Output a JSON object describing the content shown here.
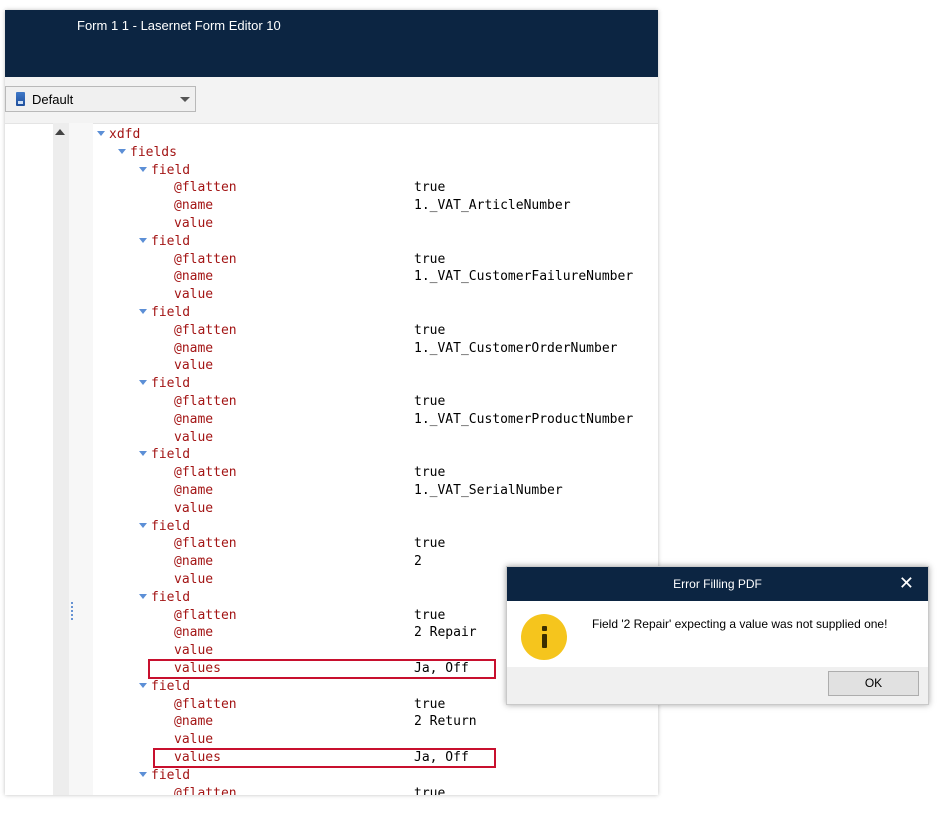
{
  "window": {
    "title": "Form 1 1 - Lasernet Form Editor 10"
  },
  "toolbar": {
    "selected_value": "Default"
  },
  "tree": {
    "root": "xdfd",
    "fields_label": "fields",
    "nodes": [
      {
        "name": "field",
        "attrs": [
          {
            "k": "@flatten",
            "v": "true"
          },
          {
            "k": "@name",
            "v": "1._VAT_ArticleNumber"
          }
        ],
        "value_label": "value"
      },
      {
        "name": "field",
        "attrs": [
          {
            "k": "@flatten",
            "v": "true"
          },
          {
            "k": "@name",
            "v": "1._VAT_CustomerFailureNumber"
          }
        ],
        "value_label": "value"
      },
      {
        "name": "field",
        "attrs": [
          {
            "k": "@flatten",
            "v": "true"
          },
          {
            "k": "@name",
            "v": "1._VAT_CustomerOrderNumber"
          }
        ],
        "value_label": "value"
      },
      {
        "name": "field",
        "attrs": [
          {
            "k": "@flatten",
            "v": "true"
          },
          {
            "k": "@name",
            "v": "1._VAT_CustomerProductNumber"
          }
        ],
        "value_label": "value"
      },
      {
        "name": "field",
        "attrs": [
          {
            "k": "@flatten",
            "v": "true"
          },
          {
            "k": "@name",
            "v": "1._VAT_SerialNumber"
          }
        ],
        "value_label": "value"
      },
      {
        "name": "field",
        "attrs": [
          {
            "k": "@flatten",
            "v": "true"
          },
          {
            "k": "@name",
            "v": "2"
          }
        ],
        "value_label": "value"
      },
      {
        "name": "field",
        "attrs": [
          {
            "k": "@flatten",
            "v": "true"
          },
          {
            "k": "@name",
            "v": "2 Repair"
          }
        ],
        "value_label": "value",
        "values": {
          "k": "values",
          "v": "Ja, Off"
        }
      },
      {
        "name": "field",
        "attrs": [
          {
            "k": "@flatten",
            "v": "true"
          },
          {
            "k": "@name",
            "v": "2 Return"
          }
        ],
        "value_label": "value",
        "values": {
          "k": "values",
          "v": "Ja, Off"
        }
      },
      {
        "name": "field",
        "attrs": [
          {
            "k": "@flatten",
            "v": "true"
          }
        ]
      }
    ]
  },
  "dialog": {
    "title": "Error Filling PDF",
    "close_glyph": "✕",
    "message": "Field '2 Repair' expecting a value was not supplied one!",
    "ok_label": "OK"
  },
  "colors": {
    "titlebar": "#0c2542",
    "key": "#a31515",
    "twisty": "#5c8fd6",
    "highlight": "#c8102e",
    "info": "#f5c51d"
  }
}
